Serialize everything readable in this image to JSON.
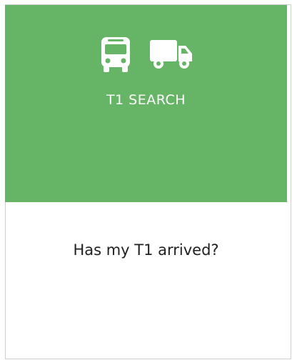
{
  "card": {
    "title": "T1 SEARCH",
    "question": "Has my T1 arrived?",
    "icons": [
      "bus-icon",
      "truck-icon"
    ],
    "header_color": "#66b466"
  }
}
